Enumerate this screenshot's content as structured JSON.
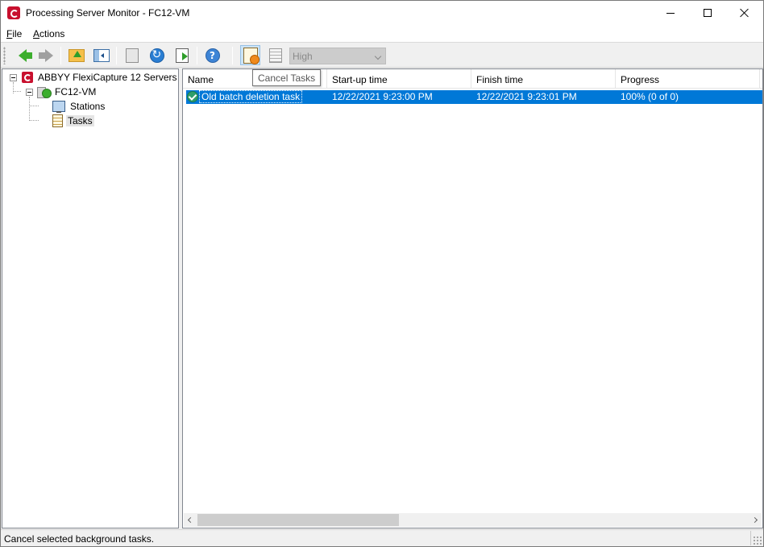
{
  "window": {
    "title": "Processing Server Monitor - FC12-VM"
  },
  "menu": {
    "file": "File",
    "actions": "Actions"
  },
  "toolbar": {
    "icons": [
      "back-arrow-icon",
      "forward-arrow-icon",
      "up-folder-icon",
      "show-hide-pane-icon",
      "properties-icon",
      "refresh-icon",
      "export-icon",
      "help-icon",
      "cancel-tasks-icon",
      "log-icon"
    ],
    "priority_value": "High",
    "tooltip": "Cancel Tasks"
  },
  "tree": {
    "root": "ABBYY FlexiCapture 12 Servers",
    "server": "FC12-VM",
    "children": [
      {
        "label": "Stations"
      },
      {
        "label": "Tasks"
      }
    ],
    "selected": "Tasks"
  },
  "list": {
    "columns": [
      "Name",
      "Start-up time",
      "Finish time",
      "Progress"
    ],
    "rows": [
      {
        "name": "Old batch deletion task",
        "startup_time": "12/22/2021 9:23:00 PM",
        "finish_time": "12/22/2021 9:23:01 PM",
        "progress": "100% (0 of 0)",
        "status_icon": "completed-check-icon"
      }
    ]
  },
  "status": {
    "text": "Cancel selected background tasks."
  },
  "colors": {
    "selection": "#0078d7",
    "brand": "#c8102e"
  }
}
